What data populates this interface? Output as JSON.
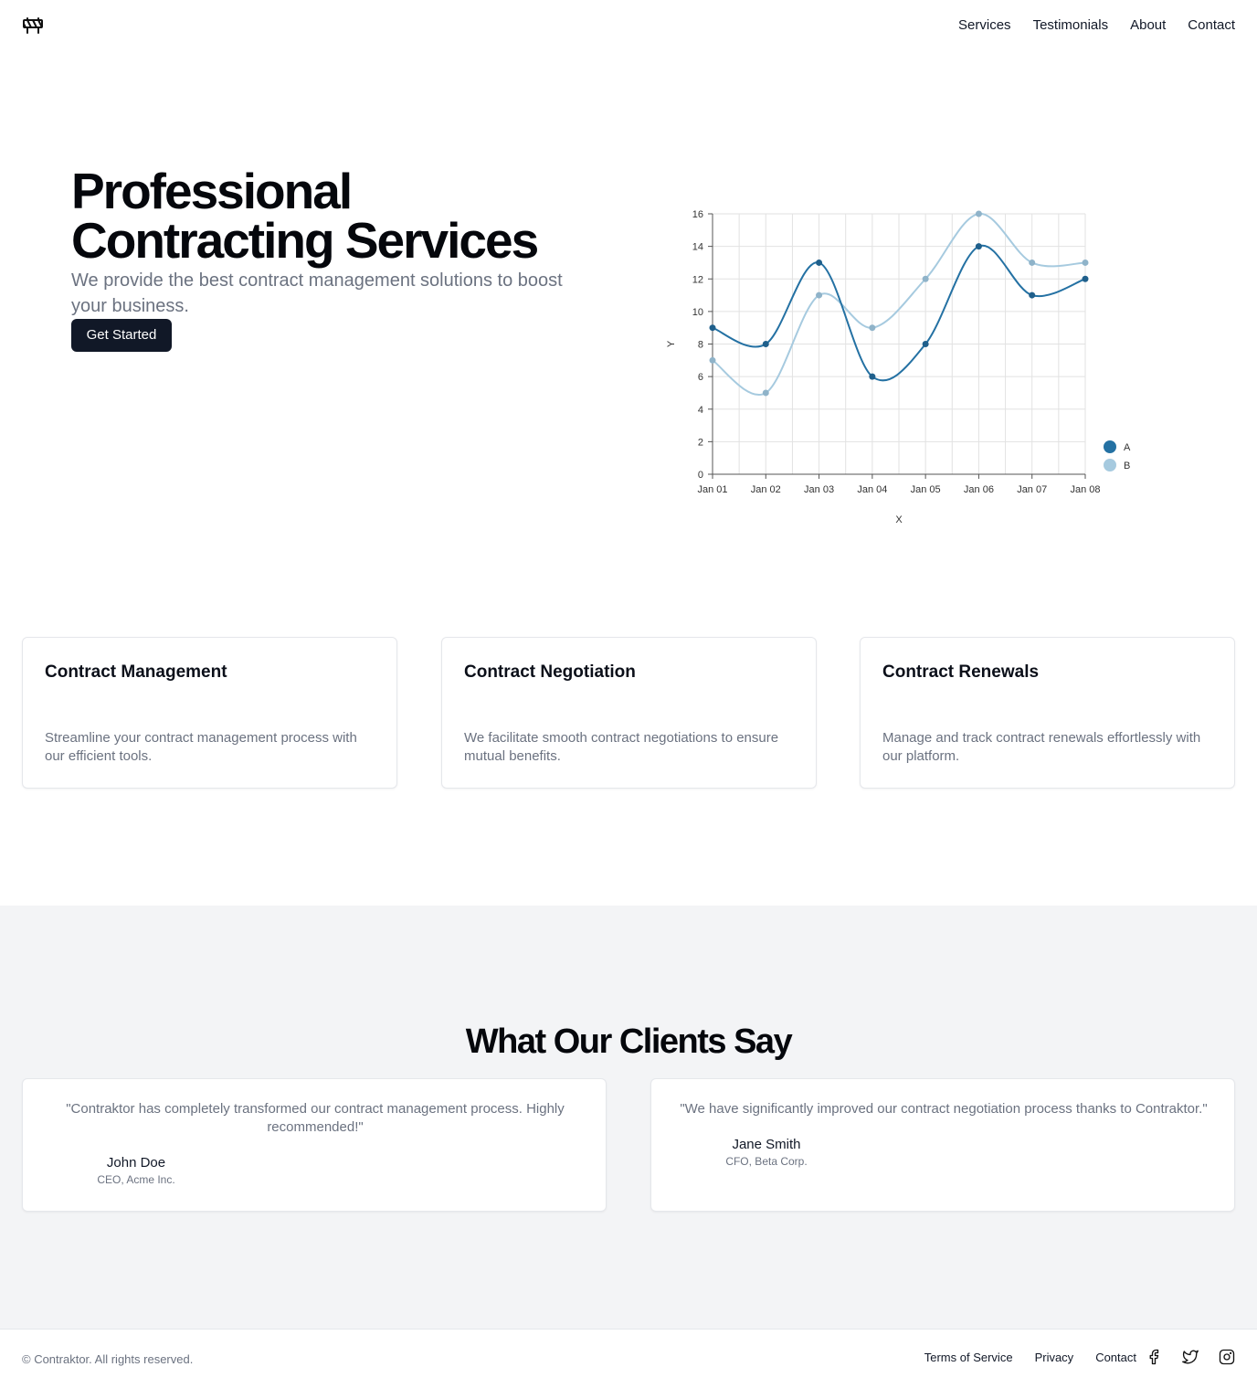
{
  "header": {
    "logo_icon": "road-barrier-icon",
    "nav": [
      "Services",
      "Testimonials",
      "About",
      "Contact"
    ]
  },
  "hero": {
    "title": "Professional Contracting Services",
    "subtitle": "We provide the best contract management solutions to boost your business.",
    "cta_label": "Get Started"
  },
  "chart_data": {
    "type": "line",
    "categories": [
      "Jan 01",
      "Jan 02",
      "Jan 03",
      "Jan 04",
      "Jan 05",
      "Jan 06",
      "Jan 07",
      "Jan 08"
    ],
    "series": [
      {
        "name": "A",
        "values": [
          9,
          8,
          13,
          6,
          8,
          14,
          11,
          12
        ],
        "color": "#2471a3"
      },
      {
        "name": "B",
        "values": [
          7,
          5,
          11,
          9,
          12,
          16,
          13,
          13
        ],
        "color": "#a6cadf"
      }
    ],
    "xlabel": "X",
    "ylabel": "Y",
    "ylim": [
      0,
      16
    ],
    "yticks": [
      0,
      2,
      4,
      6,
      8,
      10,
      12,
      14,
      16
    ],
    "grid": true,
    "legend": "right"
  },
  "services": [
    {
      "title": "Contract Management",
      "description": "Streamline your contract management process with our efficient tools."
    },
    {
      "title": "Contract Negotiation",
      "description": "We facilitate smooth contract negotiations to ensure mutual benefits."
    },
    {
      "title": "Contract Renewals",
      "description": "Manage and track contract renewals effortlessly with our platform."
    }
  ],
  "testimonials": {
    "title": "What Our Clients Say",
    "items": [
      {
        "quote": "\"Contraktor has completely transformed our contract management process. Highly recommended!\"",
        "name": "John Doe",
        "role": "CEO, Acme Inc."
      },
      {
        "quote": "\"We have significantly improved our contract negotiation process thanks to Contraktor.\"",
        "name": "Jane Smith",
        "role": "CFO, Beta Corp."
      }
    ]
  },
  "footer": {
    "copyright": "© Contraktor. All rights reserved.",
    "links": [
      "Terms of Service",
      "Privacy",
      "Contact"
    ],
    "social_icons": [
      "facebook-icon",
      "twitter-icon",
      "instagram-icon"
    ]
  }
}
